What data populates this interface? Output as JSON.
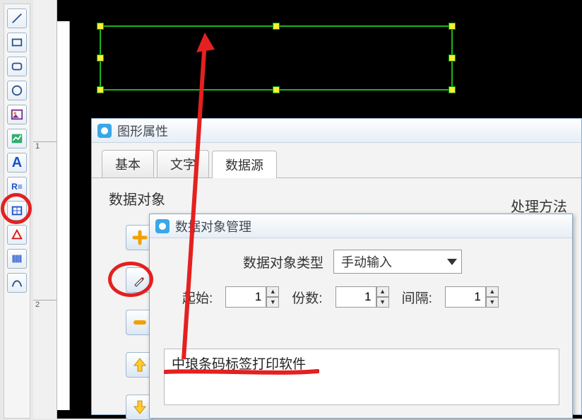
{
  "ruler": {
    "mark1": "1",
    "mark2": "2"
  },
  "dialog_props": {
    "title": "图形属性",
    "tabs": {
      "basic": "基本",
      "text": "文字",
      "data": "数据源"
    },
    "data_objects_label": "数据对象",
    "proc_method_label": "处理方法"
  },
  "dialog_data": {
    "title": "数据对象管理",
    "type_label": "数据对象类型",
    "type_value": "手动输入",
    "start_label": "起始:",
    "start_value": "1",
    "copies_label": "份数:",
    "copies_value": "1",
    "interval_label": "间隔:",
    "interval_value": "1",
    "result_text": "中琅条码标签打印软件"
  }
}
